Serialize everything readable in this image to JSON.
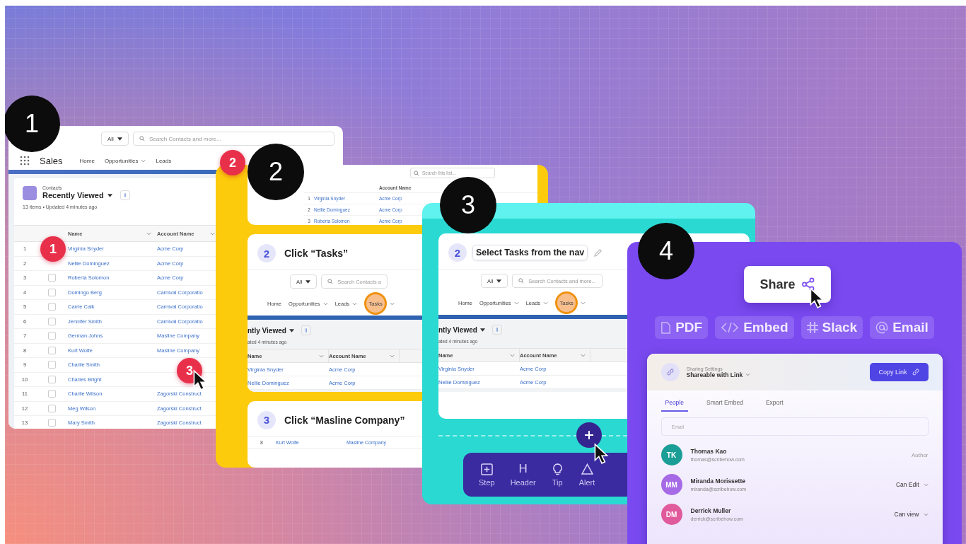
{
  "badges": [
    {
      "label": "1"
    },
    {
      "label": "2"
    },
    {
      "label": "3"
    },
    {
      "label": "4"
    }
  ],
  "markers": [
    {
      "label": "1"
    },
    {
      "label": "2"
    },
    {
      "label": "3"
    }
  ],
  "contacts_app": {
    "search_scope": "All",
    "search_placeholder": "Search Contacts and more...",
    "app_name": "Sales",
    "nav": [
      {
        "label": "Home",
        "dropdown": false
      },
      {
        "label": "Opportunities",
        "dropdown": true
      },
      {
        "label": "Leads",
        "dropdown": false
      }
    ],
    "object": "Contacts",
    "list_view": "Recently Viewed",
    "status": "13 items • Updated 4 minutes ago",
    "columns": [
      "Name",
      "Account Name"
    ],
    "rows": [
      {
        "number": "1",
        "name": "Virginia Snyder",
        "account": "Acme Corp"
      },
      {
        "number": "2",
        "name": "Nellie Dominguez",
        "account": "Acme Corp"
      },
      {
        "number": "3",
        "checked": false,
        "name": "Roberta Solomon",
        "account": "Acme Corp"
      },
      {
        "number": "4",
        "checked": false,
        "name": "Domingo Berg",
        "account": "Carnival Corporatio"
      },
      {
        "number": "5",
        "checked": false,
        "name": "Carrie Calk",
        "account": "Carnival Corporatio"
      },
      {
        "number": "6",
        "checked": false,
        "name": "Jennifer Smith",
        "account": "Carnival Corporatio"
      },
      {
        "number": "7",
        "checked": false,
        "name": "German Johns",
        "account": "Masline Company"
      },
      {
        "number": "8",
        "checked": false,
        "name": "Kurt Wolfe",
        "account": "Masline Company"
      },
      {
        "number": "9",
        "checked": false,
        "name": "Charlie Smith"
      },
      {
        "number": "10",
        "checked": false,
        "name": "Charles Bright"
      },
      {
        "number": "11",
        "checked": false,
        "name": "Charlie Wilson",
        "account": "Zagorski Construct"
      },
      {
        "number": "12",
        "checked": false,
        "name": "Meg Wilson",
        "account": "Zagorski Construct"
      },
      {
        "number": "13",
        "checked": false,
        "name": "Mary Smith",
        "account": "Zagorski Construct"
      }
    ]
  },
  "guide": {
    "top_card": {
      "search_placeholder": "Search this list...",
      "column": "Account Name",
      "rows": [
        {
          "number": "1",
          "name": "Virginia Snyder",
          "account": "Acme Corp"
        },
        {
          "number": "2",
          "name": "Nellie Dominguez",
          "account": "Acme Corp"
        },
        {
          "number": "3",
          "name": "Roberta Solomon",
          "account": "Acme Corp"
        }
      ]
    },
    "steps": [
      {
        "kind": "screenshot",
        "number": "2",
        "title": "Click “Tasks”",
        "screenshot": {
          "search_scope": "All",
          "search_placeholder": "Search Contacts a",
          "nav": [
            {
              "label": "Home",
              "dropdown": false,
              "highlighted": false
            },
            {
              "label": "Opportunities",
              "dropdown": true,
              "highlighted": false
            },
            {
              "label": "Leads",
              "dropdown": true,
              "highlighted": false
            },
            {
              "label": "Tasks",
              "dropdown": true,
              "highlighted": true
            }
          ],
          "list_view": "ntly Viewed",
          "status": "ated 4 minutes ago",
          "columns": [
            "Name",
            "Account Name"
          ],
          "rows": [
            {
              "name": "Virginia Snyder",
              "account": "Acme Corp"
            },
            {
              "name": "Nellie Dominguez",
              "account": "Acme Corp"
            }
          ]
        }
      },
      {
        "kind": "rows",
        "number": "3",
        "title": "Click “Masline Company”",
        "rows": [
          {
            "number": "8",
            "name": "Kurt Wolfe",
            "account": "Masline Company"
          }
        ]
      }
    ]
  },
  "editor": {
    "step": {
      "number": "2",
      "title": "Select Tasks from the nav",
      "screenshot": {
        "search_scope": "All",
        "search_placeholder": "Search Contacts and more...",
        "nav": [
          {
            "label": "Home",
            "dropdown": false,
            "highlighted": false
          },
          {
            "label": "Opportunities",
            "dropdown": true,
            "highlighted": false
          },
          {
            "label": "Leads",
            "dropdown": true,
            "highlighted": false
          },
          {
            "label": "Tasks",
            "dropdown": true,
            "highlighted": true
          }
        ],
        "list_view": "ntly Viewed",
        "status": "ated 4 minutes ago",
        "columns": [
          "Name",
          "Account Name"
        ],
        "rows": [
          {
            "name": "Virginia Snyder",
            "account": "Acme Corp"
          },
          {
            "name": "Nellie Dominguez",
            "account": "Acme Corp"
          }
        ]
      }
    },
    "toolbar": [
      {
        "kind": "step",
        "label": "Step"
      },
      {
        "kind": "header",
        "glyph": "H",
        "label": "Header"
      },
      {
        "kind": "tip",
        "label": "Tip"
      },
      {
        "kind": "alert",
        "label": "Alert"
      }
    ]
  },
  "share": {
    "button": "Share",
    "options": [
      {
        "kind": "pdf",
        "label": "PDF"
      },
      {
        "kind": "embed",
        "label": "Embed"
      },
      {
        "kind": "slack",
        "label": "Slack"
      },
      {
        "kind": "email",
        "label": "Email"
      }
    ],
    "panel": {
      "settings_label": "Sharing Settings",
      "access": "Shareable with Link",
      "copy_button": "Copy Link",
      "tabs": [
        {
          "label": "People",
          "selected": true
        },
        {
          "label": "Smart Embed",
          "selected": false
        },
        {
          "label": "Export",
          "selected": false
        }
      ],
      "email_placeholder": "Email",
      "people": [
        {
          "initials": "TK",
          "color": "#1a9e96",
          "name": "Thomas Kao",
          "email": "thomas@scribehow.com",
          "role": "Author",
          "kind": "label"
        },
        {
          "initials": "MM",
          "color": "#a66ae6",
          "name": "Miranda Morissette",
          "email": "miranda@scribehow.com",
          "role": "Can Edit",
          "kind": "dropdown"
        },
        {
          "initials": "DM",
          "color": "#e05a9c",
          "name": "Derrick Muller",
          "email": "derrick@scribehow.com",
          "role": "Can view",
          "kind": "dropdown"
        }
      ]
    }
  }
}
